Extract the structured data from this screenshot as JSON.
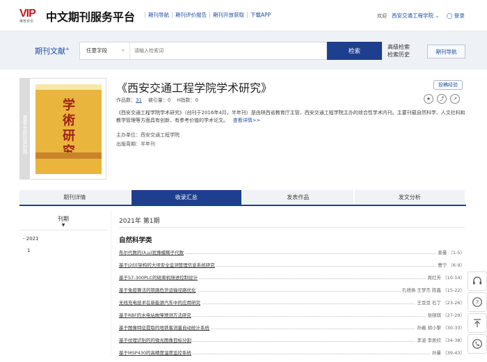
{
  "header": {
    "logo_text": "VIP",
    "logo_sub": "维普资讯",
    "brand": "中文期刊服务平台",
    "nav": [
      "期刊导航",
      "期刊评价报告",
      "期刊开放获取",
      "下载APP"
    ],
    "welcome": "欢迎",
    "user": "西安交通工程学院",
    "login": "登录"
  },
  "search": {
    "title": "期刊文献",
    "field": "任意字段",
    "placeholder": "请输入检索词",
    "button": "检索",
    "advanced": "高级检索",
    "history": "检索历史",
    "journal_nav": "期刊导航"
  },
  "journal": {
    "side_label": "查看全部目录封面",
    "title": "《西安交通工程学院学术研究》",
    "works_label": "作品数：",
    "works": "31",
    "cited_label": "被引量：",
    "cited": "0",
    "h_label": "H指数：",
    "h": "0",
    "desc": "《西安交通工程学院学术研究》（创刊于2016年4月，半年刊）是由陕西省教育厅主管、西安交通工程学院主办的综合性学术内刊。主要刊载自然科学、人文社科和教学管理等方面具有创新、有参考价值的学术论文。",
    "more": "查看详情>>",
    "sponsor_label": "主办单位：",
    "sponsor": "西安交通工程学院",
    "cycle_label": "出版周期：",
    "cycle": "半年刊",
    "submit": "投稿经验",
    "cover_text": "学術研究"
  },
  "tabs": [
    "期刊详情",
    "收录汇总",
    "发表作品",
    "发文分析"
  ],
  "active_tab": 1,
  "sidebar": {
    "heading": "刊期",
    "year": "2021",
    "issue": "1"
  },
  "content": {
    "issue_title": "2021年 第1期",
    "section": "自然科学类",
    "articles": [
      {
        "title": "布尔代数的(λ,μ)犹豫模糊子代数",
        "authors": "姜曼 （1-5）"
      },
      {
        "title": "基于J2EE架构的大坝安全监测管理信息系统研究",
        "authors": "曹宁 （6-9）"
      },
      {
        "title": "基于S7-300PLC的硫离机随进控制设计",
        "authors": "周红芳 （10-14）"
      },
      {
        "title": "基于免疫算法的铁路危货运输径路优化",
        "authors": "孔德扬 王梦杰 陈鑫 （15-22）"
      },
      {
        "title": "无线充电技术在新能源汽车中的应用研究",
        "authors": "王豆豆 石丁 （23-26）"
      },
      {
        "title": "基于RBF的水电站故障预测方法研究",
        "authors": "张硕琪 （27-29）"
      },
      {
        "title": "基于图像特征提取的地铁客流量自动统计系统",
        "authors": "孙義 胡小黎 （30-33）"
      },
      {
        "title": "基于纹理识别的的微光图像目标分割",
        "authors": "李波 李辰欣 （34-38）"
      },
      {
        "title": "基于MSP430的高精度温度监控系统",
        "authors": "孙曼 （39-43）"
      }
    ]
  },
  "float_tools": [
    "headset-icon",
    "question-icon",
    "top-icon",
    "phone-icon"
  ],
  "colors": {
    "primary": "#1e3f8f",
    "link": "#1d4fa1",
    "logo_red": "#c8161d"
  }
}
